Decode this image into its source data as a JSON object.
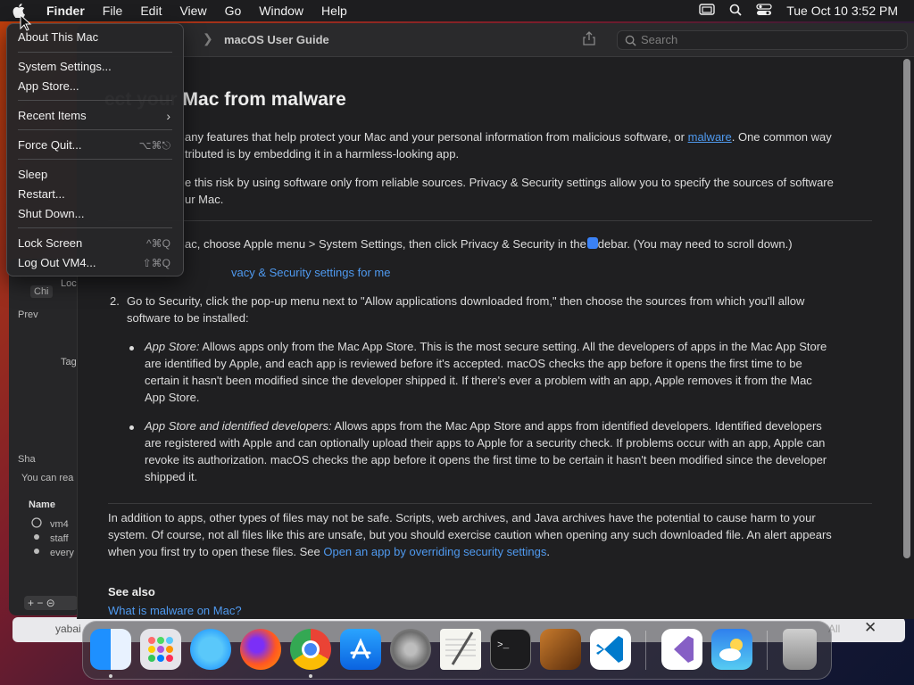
{
  "menubar": {
    "app_name": "Finder",
    "menus": [
      "File",
      "Edit",
      "View",
      "Go",
      "Window",
      "Help"
    ],
    "datetime": "Tue Oct 10  3:52 PM"
  },
  "apple_menu": {
    "items": [
      {
        "label": "About This Mac"
      },
      {
        "label": "System Settings..."
      },
      {
        "label": "App Store..."
      },
      {
        "label": "Recent Items"
      },
      {
        "label": "Force Quit...",
        "shortcut": "⌥⌘⎋"
      },
      {
        "label": "Sleep"
      },
      {
        "label": "Restart..."
      },
      {
        "label": "Shut Down..."
      },
      {
        "label": "Lock Screen",
        "shortcut": "^⌘Q"
      },
      {
        "label": "Log Out VM4...",
        "shortcut": "⇧⌘Q"
      }
    ]
  },
  "background_window": {
    "labels": [
      "Chi",
      "Loc",
      "Prev",
      "Tag",
      "Sha",
      "You can rea",
      "Name",
      "vm4",
      "staff",
      "every"
    ],
    "bottom_tab": "yabai",
    "bottom_right": "All"
  },
  "help": {
    "breadcrumb": "macOS User Guide",
    "search_placeholder": "Search",
    "heading": "ect your Mac from malware",
    "intro_1a": "any features that help protect your Mac and your personal information from malicious software, or ",
    "intro_1_link": "malware",
    "intro_1b": ". One common way",
    "intro_1c": "tributed is by embedding it in a harmless-looking app.",
    "intro_2a": "e this risk by using software only from reliable sources. Privacy & Security settings allow you to specify the sources of software",
    "intro_2b": "ur Mac.",
    "step1_text": "ac, choose Apple menu  > System Settings, then click Privacy & Security  in the sidebar. (You may need to scroll down.)",
    "step1_link": "vacy & Security settings for me",
    "step2_num": "2.",
    "step2_a": "Go to Security, click the pop-up menu next to \"Allow applications downloaded from,\" then choose the sources from which you'll allow",
    "step2_b": "software to be installed:",
    "b1_title": "App Store:",
    "b1_l1": " Allows apps only from the Mac App Store. This is the most secure setting. All the developers of apps in the Mac App Store",
    "b1_l2": "are identified by Apple, and each app is reviewed before it's accepted. macOS checks the app before it opens the first time to be",
    "b1_l3": "certain it hasn't been modified since the developer shipped it. If there's ever a problem with an app, Apple removes it from the Mac",
    "b1_l4": "App Store.",
    "b2_title": "App Store and identified developers:",
    "b2_l1": " Allows apps from the Mac App Store and apps from identified developers. Identified developers",
    "b2_l2": "are registered with Apple and can optionally upload their apps to Apple for a security check. If problems occur with an app, Apple can",
    "b2_l3": "revoke its authorization. macOS checks the app before it opens the first time to be certain it hasn't been modified since the developer",
    "b2_l4": "shipped it.",
    "p3_l1": "In addition to apps, other types of files may not be safe. Scripts, web archives, and Java archives have the potential to cause harm to your",
    "p3_l2": "system. Of course, not all files like this are unsafe, but you should exercise caution when opening any such downloaded file. An alert appears",
    "p3_l3a": "when you first try to open these files. See ",
    "p3_link": "Open an app by overriding security settings",
    "p3_l3b": ".",
    "see_also": "See also",
    "see_also_link": "What is malware on Mac?"
  },
  "colors": {
    "accent": "#4f9af0",
    "menu_bg": "#262628",
    "window_bg": "#1f1f21"
  },
  "dock_icons": [
    "finder-icon",
    "launchpad-icon",
    "safari-icon",
    "firefox-icon",
    "chrome-icon",
    "app-store-icon",
    "system-settings-icon",
    "textedit-icon",
    "terminal-icon",
    "garageband-icon",
    "vscode-icon",
    "visual-studio-icon",
    "weather-icon",
    "trash-icon"
  ]
}
